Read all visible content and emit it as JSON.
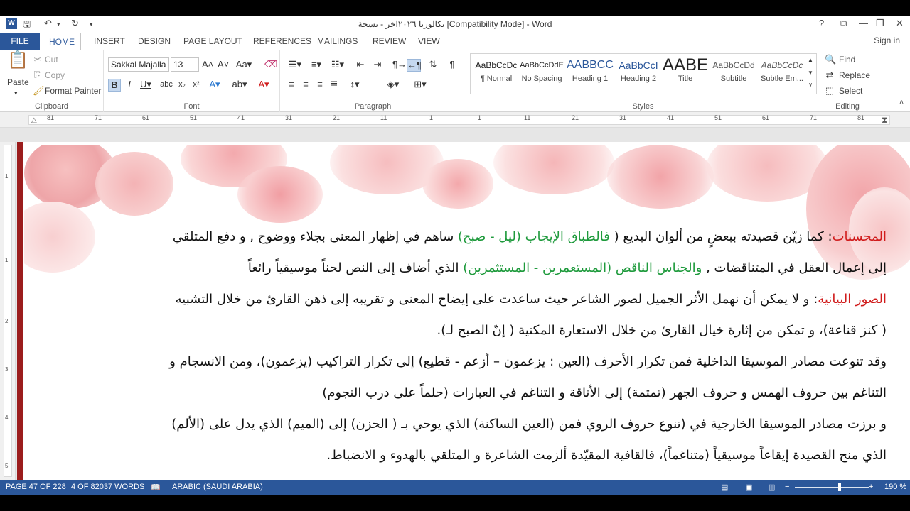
{
  "window": {
    "title": "بكالوريا ٢٠٢٦اخر - نسخة [Compatibility Mode] - Word",
    "controls": [
      "?",
      "⧉",
      "—",
      "❐",
      "✕"
    ]
  },
  "tabs": {
    "file": "FILE",
    "items": [
      "HOME",
      "INSERT",
      "DESIGN",
      "PAGE LAYOUT",
      "REFERENCES",
      "MAILINGS",
      "REVIEW",
      "VIEW"
    ],
    "active": "HOME",
    "signin": "Sign in"
  },
  "ribbon": {
    "clipboard": {
      "label": "Clipboard",
      "paste": "Paste",
      "cut": "Cut",
      "copy": "Copy",
      "format_painter": "Format Painter"
    },
    "font": {
      "label": "Font",
      "family": "Sakkal Majalla",
      "size": "13"
    },
    "paragraph": {
      "label": "Paragraph"
    },
    "styles": {
      "label": "Styles",
      "items": [
        {
          "preview": "AaBbCcDc",
          "name": "¶ Normal"
        },
        {
          "preview": "AaBbCcDdE",
          "name": "No Spacing"
        },
        {
          "preview": "AABBCC",
          "name": "Heading 1"
        },
        {
          "preview": "AaBbCcI",
          "name": "Heading 2"
        },
        {
          "preview": "AABE",
          "name": "Title"
        },
        {
          "preview": "AaBbCcDd",
          "name": "Subtitle"
        },
        {
          "preview": "AaBbCcDc",
          "name": "Subtle Em..."
        }
      ]
    },
    "editing": {
      "label": "Editing",
      "find": "Find",
      "replace": "Replace",
      "select": "Select"
    }
  },
  "ruler": {
    "ticks": [
      "81",
      "71",
      "61",
      "51",
      "41",
      "31",
      "21",
      "11",
      "1",
      "1",
      "11",
      "21",
      "31",
      "41",
      "51",
      "61",
      "71",
      "81"
    ]
  },
  "vruler": {
    "ticks": [
      "1",
      "1",
      "2",
      "3",
      "4",
      "5"
    ]
  },
  "document": {
    "p1_label": "المحسنات",
    "p1_a": ": كما زيّن قصيدته ببعضٍ من ألوان البديع ( ",
    "p1_green1": "فالطباق الإيجاب (ليل - صبح)",
    "p1_b": " ساهم في إظهار المعنى بجلاء ووضوح , و دفع المتلقي",
    "p1_line2_a": "إلى إعمال العقل في المتناقضات , ",
    "p1_green2": "والجناس الناقص (المستعمرين - المستثمرين)",
    "p1_line2_b": " الذي أضاف إلى النص لحناً موسيقياً رائعاً",
    "p2_label": "الصور البيانية",
    "p2_line1": ": و لا يمكن أن نهمل الأثر الجميل لصور الشاعر حيث ساعدت على إيضاح المعنى و تقريبه إلى ذهن القارئ من خلال التشبيه",
    "p2_line2": "( كنز قناعة)، و تمكن من إثارة خيال القارئ من خلال الاستعارة المكنية ( إنّ الصبح لـ).",
    "p3_line1": "وقد تنوعت مصادر الموسيقا الداخلية فمن تكرار الأحرف (العين : يزعمون – أزعم - قطيع) إلى تكرار التراكيب (يزعمون)، ومن الانسجام و",
    "p3_line2": "التناغم بين حروف الهمس و حروف الجهر (تمتمة) إلى الأناقة و التناغم في العبارات (حلماً على درب النجوم)",
    "p4_line1": "و برزت مصادر الموسيقا الخارجية في (تنوع حروف الروي فمن (العين الساكنة) الذي يوحي بـ ( الحزن) إلى (الميم) الذي يدل على (الألم)",
    "p4_line2": "الذي منح القصيدة إيقاعاً موسيقياً (متناغماً)، فالقافية المقيّدة ألزمت الشاعرة و المتلقي بالهدوء و الانضباط."
  },
  "status": {
    "page": "PAGE 47 OF 228",
    "words": "4 OF 82037 WORDS",
    "language": "ARABIC (SAUDI ARABIA)",
    "zoom": "190 %"
  },
  "colors": {
    "brand": "#2b579a",
    "heading_red": "#d01b1b",
    "highlight_green": "#1e9a3c"
  }
}
